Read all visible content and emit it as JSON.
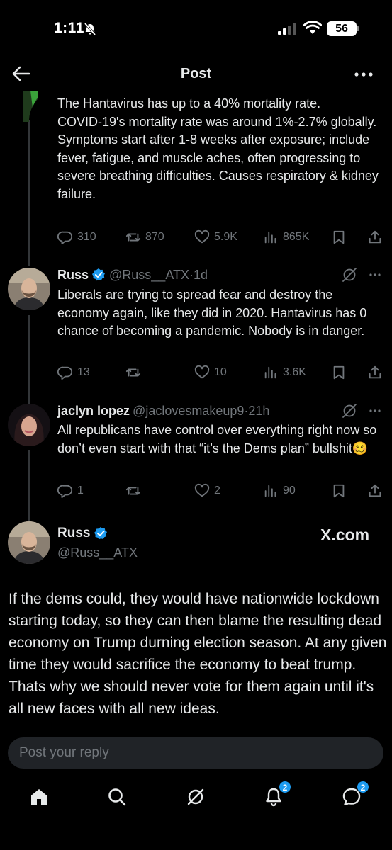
{
  "status_bar": {
    "time": "1:11",
    "battery": "56"
  },
  "header": {
    "title": "Post"
  },
  "tweets": [
    {
      "text": "The Hantavirus has up to a 40% mortality rate.\nCOVID-19's mortality rate was around 1%-2.7% globally.\nSymptoms start after 1-8 weeks after exposure; include fever, fatigue, and muscle aches, often progressing to severe breathing difficulties. Causes respiratory & kidney failure.",
      "replies": "310",
      "reposts": "870",
      "likes": "5.9K",
      "views": "865K"
    },
    {
      "name": "Russ",
      "handle": "@Russ__ATX",
      "time": "1d",
      "text": "Liberals are trying to spread fear and destroy the economy again, like they did in 2020. Hantavirus has 0 chance of becoming a pandemic. Nobody is in danger.",
      "replies": "13",
      "reposts": "",
      "likes": "10",
      "views": "3.6K"
    },
    {
      "name": "jaclyn lopez",
      "handle": "@jaclovesmakeup9",
      "time": "21h",
      "text": "All republicans have control over everything right now so don’t even start with that “it’s the Dems plan” bullshit🥴",
      "replies": "1",
      "reposts": "",
      "likes": "2",
      "views": "90"
    }
  ],
  "main_post": {
    "name": "Russ",
    "handle": "@Russ__ATX",
    "watermark": "X.com",
    "text": "If the dems could, they would have nationwide lockdown starting today, so they can then blame the resulting dead economy on Trump durning election season. At any given time they would sacrifice the economy to beat trump. Thats why we should never vote for them again until it's all new faces with all new ideas."
  },
  "reply": {
    "placeholder": "Post your reply"
  },
  "tabbar": {
    "notifications_badge": "2",
    "messages_badge": "2"
  },
  "colors": {
    "background": "#000000",
    "text": "#e7e9ea",
    "muted": "#71767b",
    "accent": "#1d9bf0"
  }
}
